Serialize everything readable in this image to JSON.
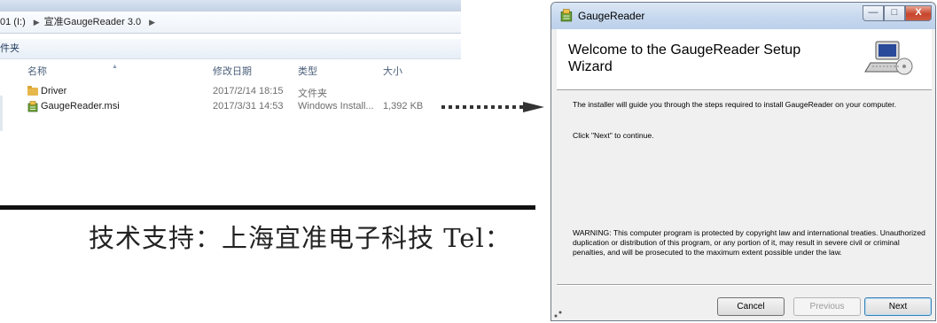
{
  "explorer": {
    "breadcrumb": [
      "01 (I:)",
      "宣准GaugeReader 3.0"
    ],
    "toolbar_label": "件夹",
    "columns": {
      "name": "名称",
      "date": "修改日期",
      "type": "类型",
      "size": "大小"
    },
    "files": [
      {
        "name": "Driver",
        "date": "2017/2/14 18:15",
        "type": "文件夹",
        "size": ""
      },
      {
        "name": "GaugeReader.msi",
        "date": "2017/3/31 14:53",
        "type": "Windows Install...",
        "size": "1,392 KB"
      }
    ]
  },
  "banner": {
    "text": "技术支持：上海宜准电子科技  Tel："
  },
  "installer": {
    "window_title": "GaugeReader",
    "header_title": "Welcome to the GaugeReader Setup Wizard",
    "intro": "The installer will guide you through the steps required to install GaugeReader on your computer.",
    "continue_hint": "Click \"Next\" to continue.",
    "warning": "WARNING: This computer program is protected by copyright law and international treaties. Unauthorized duplication or distribution of this program, or any portion of it, may result in severe civil or criminal penalties, and will be prosecuted to the maximum extent possible under the law.",
    "buttons": {
      "cancel": "Cancel",
      "previous": "Previous",
      "next": "Next"
    },
    "controls": {
      "minimize": "—",
      "maximize": "□",
      "close": "X"
    }
  },
  "icons": {
    "folder": "folder-icon",
    "msi": "msi-package-icon",
    "arrow": "dotted-arrow-icon",
    "setup_computer": "setup-computer-icon"
  },
  "colors": {
    "close_button": "#c7452c",
    "header_bg": "#ffffff",
    "dialog_bg": "#f0f0f0"
  }
}
